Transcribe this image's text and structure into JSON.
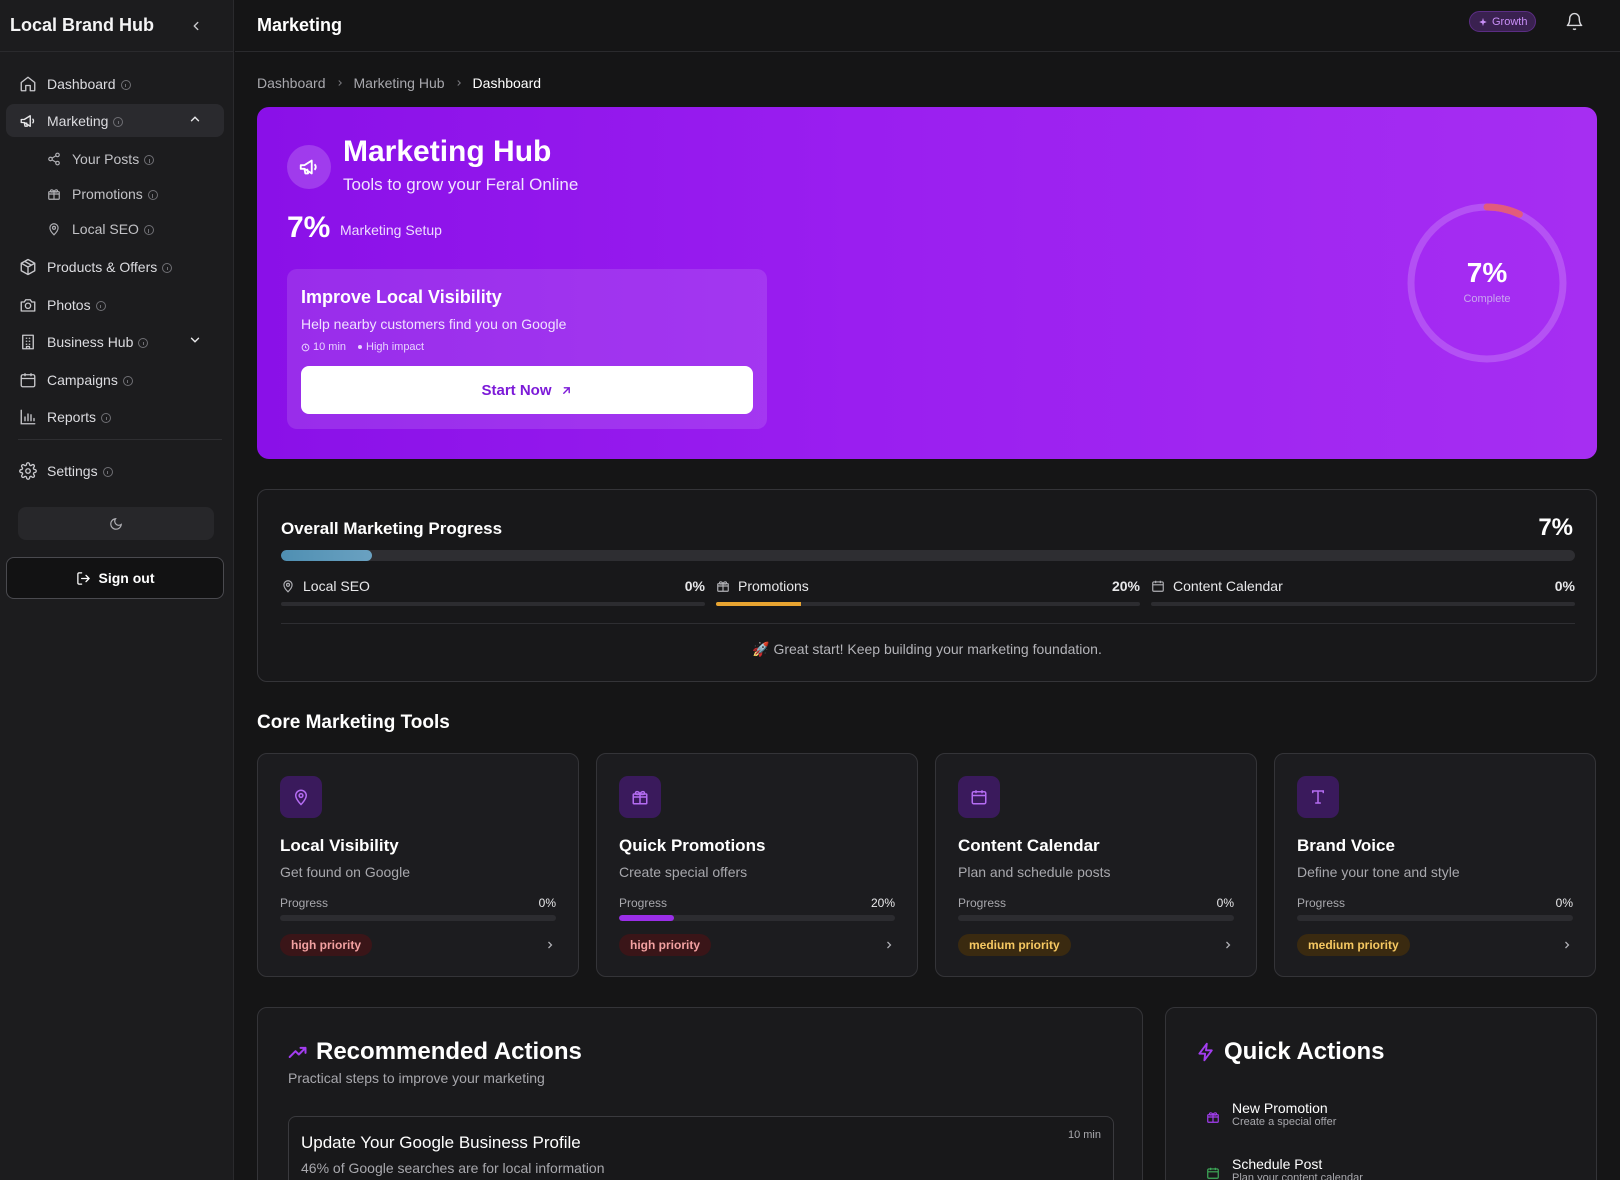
{
  "app": {
    "name": "Local Brand Hub"
  },
  "sidebar": {
    "items": [
      {
        "label": "Dashboard",
        "icon": "home-icon"
      },
      {
        "label": "Marketing",
        "icon": "megaphone-icon",
        "expanded": true
      },
      {
        "label": "Products & Offers",
        "icon": "package-icon"
      },
      {
        "label": "Photos",
        "icon": "camera-icon"
      },
      {
        "label": "Business Hub",
        "icon": "building-icon"
      },
      {
        "label": "Campaigns",
        "icon": "calendar-icon"
      },
      {
        "label": "Reports",
        "icon": "bar-chart-icon"
      }
    ],
    "sub_items": [
      {
        "label": "Your Posts",
        "icon": "share-icon"
      },
      {
        "label": "Promotions",
        "icon": "gift-icon"
      },
      {
        "label": "Local SEO",
        "icon": "map-pin-icon"
      }
    ],
    "settings": "Settings",
    "sign_out": "Sign out"
  },
  "header": {
    "title": "Marketing",
    "badge": "Growth"
  },
  "breadcrumb": [
    "Dashboard",
    "Marketing Hub",
    "Dashboard"
  ],
  "hero": {
    "title": "Marketing Hub",
    "subtitle": "Tools to grow your Feral Online",
    "percent": "7%",
    "percent_label": "Marketing Setup",
    "card": {
      "title": "Improve Local Visibility",
      "description": "Help nearby customers find you on Google",
      "time": "10 min",
      "impact": "High impact",
      "button": "Start Now"
    },
    "ring": {
      "value": 0.07,
      "percent": "7%",
      "label": "Complete"
    }
  },
  "progress": {
    "title": "Overall Marketing Progress",
    "percent": "7%",
    "value": 0.07,
    "items": [
      {
        "label": "Local SEO",
        "percent": "0%",
        "value": 0
      },
      {
        "label": "Promotions",
        "percent": "20%",
        "value": 0.2
      },
      {
        "label": "Content Calendar",
        "percent": "0%",
        "value": 0
      }
    ],
    "message": "🚀 Great start! Keep building your marketing foundation."
  },
  "tools": {
    "title": "Core Marketing Tools",
    "progress_label": "Progress",
    "cards": [
      {
        "title": "Local Visibility",
        "desc": "Get found on Google",
        "percent": "0%",
        "value": 0,
        "priority": "high priority"
      },
      {
        "title": "Quick Promotions",
        "desc": "Create special offers",
        "percent": "20%",
        "value": 0.2,
        "priority": "high priority"
      },
      {
        "title": "Content Calendar",
        "desc": "Plan and schedule posts",
        "percent": "0%",
        "value": 0,
        "priority": "medium priority"
      },
      {
        "title": "Brand Voice",
        "desc": "Define your tone and style",
        "percent": "0%",
        "value": 0,
        "priority": "medium priority"
      }
    ]
  },
  "recommended": {
    "title": "Recommended Actions",
    "subtitle": "Practical steps to improve your marketing",
    "items": [
      {
        "title": "Update Your Google Business Profile",
        "desc": "46% of Google searches are for local information",
        "time": "10 min"
      }
    ]
  },
  "quick_actions": {
    "title": "Quick Actions",
    "items": [
      {
        "title": "New Promotion",
        "desc": "Create a special offer"
      },
      {
        "title": "Schedule Post",
        "desc": "Plan your content calendar"
      }
    ]
  },
  "colors": {
    "accent": "#9a1ef0",
    "high": "#f2a1a1",
    "medium": "#f6c862"
  }
}
